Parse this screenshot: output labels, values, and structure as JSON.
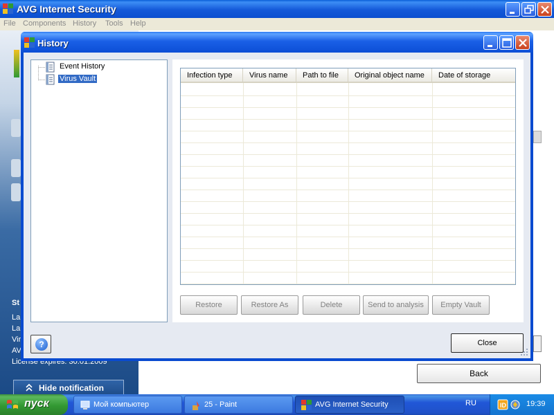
{
  "main_window": {
    "title": "AVG Internet Security",
    "menu": [
      "File",
      "Components",
      "History",
      "Tools",
      "Help"
    ],
    "left_panel": {
      "heading_fragment": "St",
      "lines": [
        "La",
        "La",
        "Vir",
        "AV"
      ],
      "license_text": "License expires: 30.01.2009",
      "hide_notification": "Hide notification"
    },
    "back_label": "Back"
  },
  "dialog": {
    "title": "History",
    "tree": [
      {
        "label": "Event History",
        "selected": false
      },
      {
        "label": "Virus Vault",
        "selected": true
      }
    ],
    "table": {
      "columns": [
        "Infection type",
        "Virus name",
        "Path to file",
        "Original object name",
        "Date of storage"
      ],
      "rows": []
    },
    "buttons": {
      "restore": "Restore",
      "restore_as": "Restore As",
      "delete": "Delete",
      "send_to_analysis": "Send to analysis",
      "empty_vault": "Empty Vault"
    },
    "help_symbol": "?",
    "close_label": "Close"
  },
  "taskbar": {
    "start_label": "пуск",
    "tasks": [
      {
        "label": "Мой компьютер",
        "active": false
      },
      {
        "label": "25 - Paint",
        "active": false
      },
      {
        "label": "AVG Internet Security",
        "active": true
      }
    ],
    "language": "RU",
    "clock": "19:39"
  },
  "icons": {
    "main_logo": "avg-logo-icon",
    "dialog_logo": "avg-logo-icon",
    "tree_item": "document-log-icon",
    "help": "help-question-icon"
  },
  "colors": {
    "titlebar_blue": "#0c4ed6",
    "selection": "#316ac5",
    "start_green": "#339933"
  }
}
